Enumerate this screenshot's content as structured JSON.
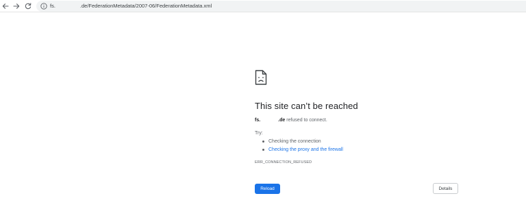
{
  "browser": {
    "back_icon": "arrow-left-icon",
    "forward_icon": "arrow-right-icon",
    "reload_icon": "reload-icon",
    "info_icon": "info-icon",
    "url_prefix": "fs.",
    "url_suffix": ".de/FederationMetadata/2007-06/FederationMetadata.xml"
  },
  "error": {
    "icon": "sad-document-icon",
    "title": "This site can’t be reached",
    "host_prefix": "fs.",
    "host_suffix": ".de",
    "message": "refused to connect.",
    "try_label": "Try:",
    "suggestions": [
      "Checking the connection",
      "Checking the proxy and the firewall"
    ],
    "error_code": "ERR_CONNECTION_REFUSED",
    "reload_label": "Reload",
    "details_label": "Details"
  },
  "colors": {
    "accent": "#1a73e8",
    "text": "#202124",
    "secondary_text": "#5f6368",
    "omnibox_bg": "#f1f3f4"
  }
}
